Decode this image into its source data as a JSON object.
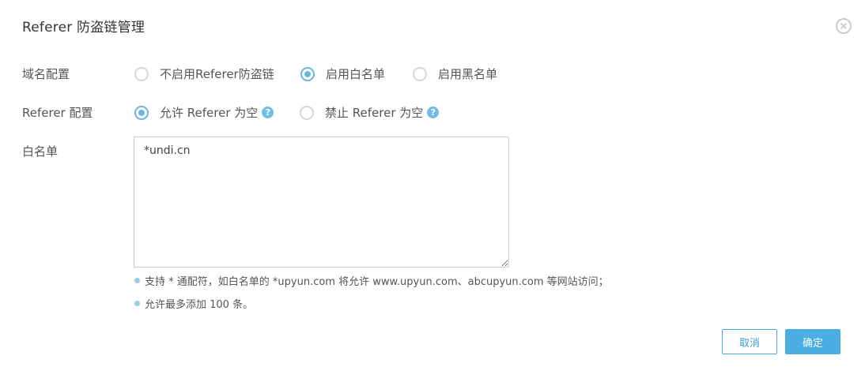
{
  "dialog": {
    "title": "Referer 防盗链管理",
    "close_icon": "close-circle-icon"
  },
  "domain_config": {
    "label": "域名配置",
    "options": [
      {
        "label": "不启用Referer防盗链",
        "checked": false
      },
      {
        "label": "启用白名单",
        "checked": true
      },
      {
        "label": "启用黑名单",
        "checked": false
      }
    ]
  },
  "referer_config": {
    "label": "Referer 配置",
    "options": [
      {
        "label": "允许 Referer 为空",
        "checked": true,
        "help_icon": "?"
      },
      {
        "label": "禁止 Referer 为空",
        "checked": false,
        "help_icon": "?"
      }
    ]
  },
  "whitelist": {
    "label": "白名单",
    "value": "*undi.cn"
  },
  "hints": [
    "支持 * 通配符，如白名单的 *upyun.com 将允许 www.upyun.com、abcupyun.com 等网站访问；",
    "允许最多添加 100 条。"
  ],
  "buttons": {
    "cancel_label": "取消",
    "ok_label": "确定"
  },
  "colors": {
    "accent": "#4aaee3",
    "radio_checked": "#6ab6e0",
    "radio_unchecked": "#d6d6d6"
  }
}
